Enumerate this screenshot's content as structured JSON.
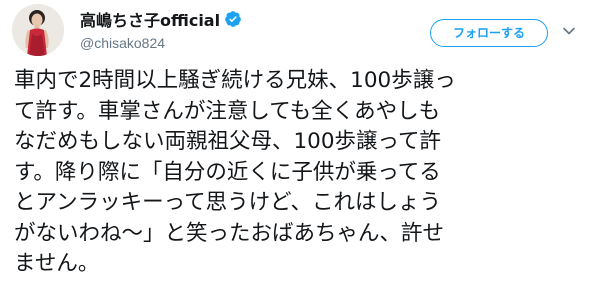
{
  "user": {
    "display_name": "高嶋ちさ子official",
    "handle": "@chisako824",
    "verified": true
  },
  "actions": {
    "follow_label": "フォローする",
    "more_icon": "chevron-down-icon"
  },
  "tweet": {
    "lines": [
      "車内で2時間以上騒ぎ続ける兄妹、100歩譲っ",
      "て許す。車掌さんが注意しても全くあやしも",
      "なだめもしない両親祖父母、100歩譲って許",
      "す。降り際に「自分の近くに子供が乗ってる",
      "とアンラッキーって思うけど、これはしょう",
      "がないわね〜」と笑ったおばあちゃん、許せ",
      "ません。"
    ]
  },
  "colors": {
    "accent": "#1da1f2",
    "text": "#14171a",
    "secondary_text": "#657786"
  }
}
